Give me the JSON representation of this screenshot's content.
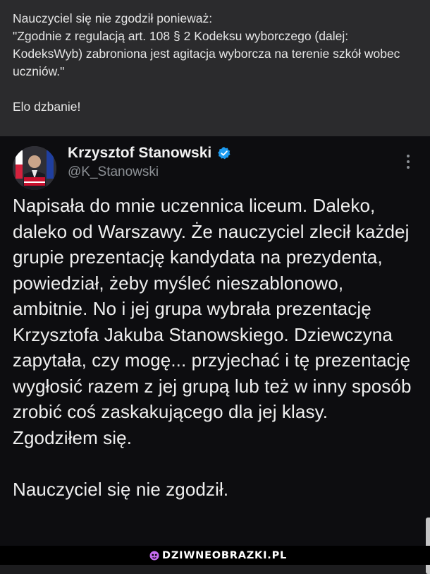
{
  "top_note": {
    "text": "Nauczyciel się nie zgodził ponieważ:\n\"Zgodnie z regulacją art. 108 § 2 Kodeksu wyborczego (dalej: KodeksWyb) zabroniona jest agitacja wyborcza na terenie szkół wobec uczniów.\"\n\nElo dzbanie!"
  },
  "tweet": {
    "author_name": "Krzysztof Stanowski",
    "handle": "@K_Stanowski",
    "body": "Napisała do mnie uczennica liceum. Daleko, daleko od Warszawy. Że nauczyciel zlecił każdej grupie prezentację kandydata na prezydenta, powiedział, żeby myśleć nieszablonowo, ambitnie. No i jej grupa wybrała prezentację Krzysztofa Jakuba Stanowskiego. Dziewczyna zapytała, czy mogę... przyjechać i tę prezentację wygłosić razem z jej grupą lub też w inny sposób zrobić coś zaskakującego dla jej klasy. Zgodziłem się.\n\nNauczyciel się nie zgodził.",
    "verified_color": "#1d9bf0",
    "icons": {
      "verified": "verified-badge-icon",
      "more": "more-options-icon"
    }
  },
  "watermark": {
    "text": "DZIWNEOBRAZKI.PL",
    "accent": "#c56cf0"
  }
}
